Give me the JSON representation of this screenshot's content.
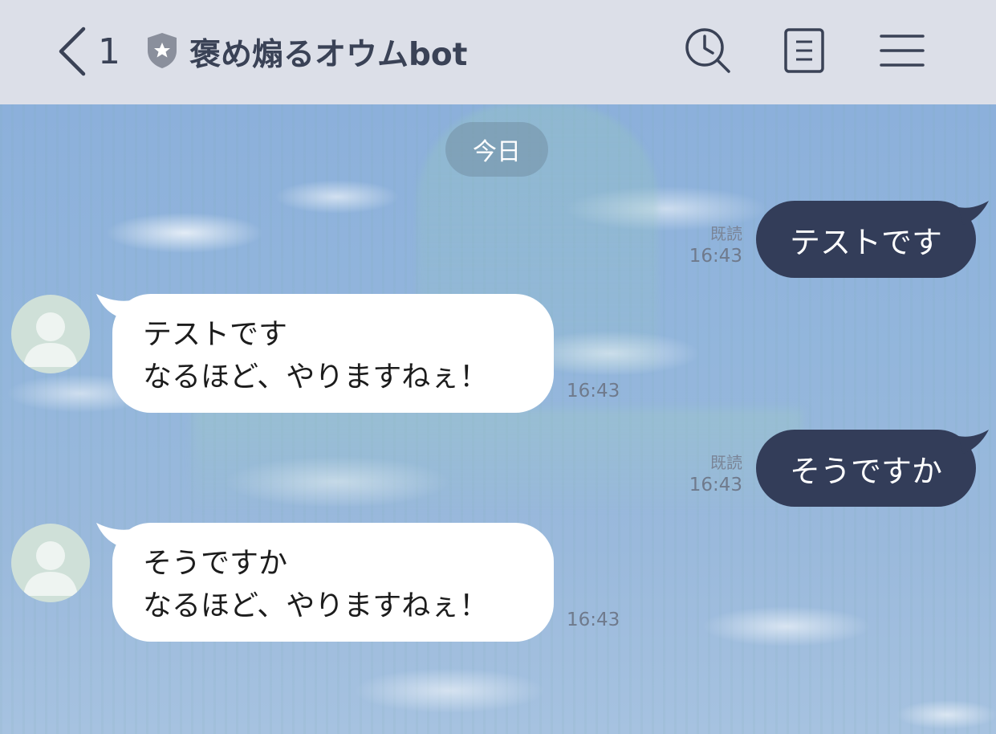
{
  "header": {
    "back_icon": "chevron-left-icon",
    "unread_count": "1",
    "badge_icon": "shield-star-icon",
    "title": "褒め煽るオウムbot",
    "search_icon": "search-clock-icon",
    "notes_icon": "notes-icon",
    "menu_icon": "hamburger-menu-icon",
    "background_color": "#dcdfe8",
    "text_color": "#3a4256"
  },
  "date_separator": "今日",
  "messages": [
    {
      "direction": "outgoing",
      "text": "テストです",
      "read_label": "既読",
      "time": "16:43"
    },
    {
      "direction": "incoming",
      "line1": "テストです",
      "line2": "なるほど、やりますねぇ！",
      "time": "16:43"
    },
    {
      "direction": "outgoing",
      "text": "そうですか",
      "read_label": "既読",
      "time": "16:43"
    },
    {
      "direction": "incoming",
      "line1": "そうですか",
      "line2": "なるほど、やりますねぇ！",
      "time": "16:43"
    }
  ],
  "colors": {
    "outgoing_bubble": "#333d59",
    "incoming_bubble": "#ffffff",
    "avatar_bg": "#cfe0d8"
  }
}
